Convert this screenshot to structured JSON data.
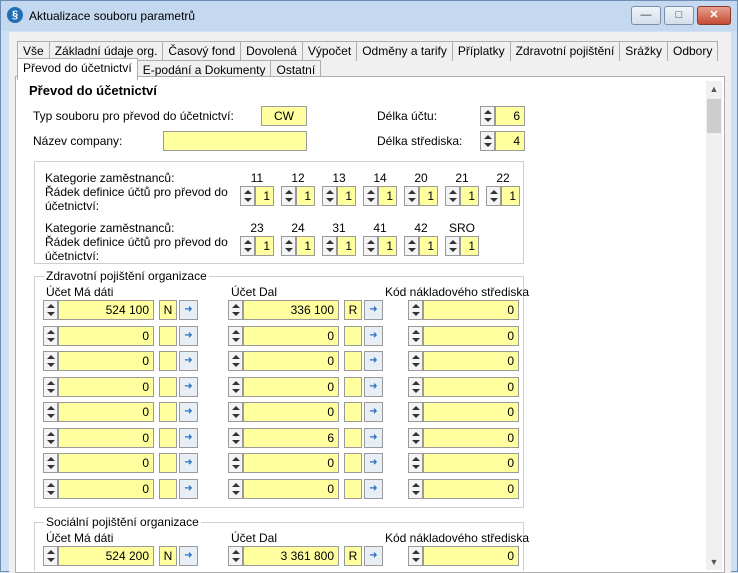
{
  "window": {
    "title": "Aktualizace souboru parametrů",
    "min_label": "—",
    "max_label": "□",
    "close_label": "✕",
    "icon": "app-logo-icon"
  },
  "tabs_row1": [
    "Vše",
    "Základní údaje org.",
    "Časový fond",
    "Dovolená",
    "Výpočet",
    "Odměny a tarify",
    "Příplatky",
    "Zdravotní pojištění",
    "Srážky",
    "Odbory"
  ],
  "tabs_row2": [
    "Převod do účetnictví",
    "E-podání a Dokumenty",
    "Ostatní"
  ],
  "active_tab": "Převod do účetnictví",
  "section_title": "Převod do účetnictví",
  "general": {
    "file_type_label": "Typ souboru pro převod do účetnictví:",
    "file_type_value": "CW",
    "company_label": "Název company:",
    "company_value": "",
    "account_len_label": "Délka účtu:",
    "account_len_value": "6",
    "center_len_label": "Délka střediska:",
    "center_len_value": "4"
  },
  "categories": {
    "cat_label": "Kategorie zaměstnanců:",
    "row_label": "Řádek definice účtů pro převod do účetnictví:",
    "row1": [
      {
        "cat": "11",
        "val": "1"
      },
      {
        "cat": "12",
        "val": "1"
      },
      {
        "cat": "13",
        "val": "1"
      },
      {
        "cat": "14",
        "val": "1"
      },
      {
        "cat": "20",
        "val": "1"
      },
      {
        "cat": "21",
        "val": "1"
      },
      {
        "cat": "22",
        "val": "1"
      }
    ],
    "row2": [
      {
        "cat": "23",
        "val": "1"
      },
      {
        "cat": "24",
        "val": "1"
      },
      {
        "cat": "31",
        "val": "1"
      },
      {
        "cat": "41",
        "val": "1"
      },
      {
        "cat": "42",
        "val": "1"
      },
      {
        "cat": "SRO",
        "val": "1"
      }
    ]
  },
  "health": {
    "group_label": "Zdravotní pojištění organizace",
    "col_debit": "Účet Má dáti",
    "col_credit": "Účet Dal",
    "col_center": "Kód nákladového střediska",
    "rows": [
      {
        "debit": "524 100",
        "dflag": "N",
        "credit": "336 100",
        "cflag": "R",
        "center": "0"
      },
      {
        "debit": "0",
        "dflag": "",
        "credit": "0",
        "cflag": "",
        "center": "0"
      },
      {
        "debit": "0",
        "dflag": "",
        "credit": "0",
        "cflag": "",
        "center": "0"
      },
      {
        "debit": "0",
        "dflag": "",
        "credit": "0",
        "cflag": "",
        "center": "0"
      },
      {
        "debit": "0",
        "dflag": "",
        "credit": "0",
        "cflag": "",
        "center": "0"
      },
      {
        "debit": "0",
        "dflag": "",
        "credit": "6",
        "cflag": "",
        "center": "0"
      },
      {
        "debit": "0",
        "dflag": "",
        "credit": "0",
        "cflag": "",
        "center": "0"
      },
      {
        "debit": "0",
        "dflag": "",
        "credit": "0",
        "cflag": "",
        "center": "0"
      }
    ]
  },
  "social": {
    "group_label": "Sociální pojištění organizace",
    "col_debit": "Účet Má dáti",
    "col_credit": "Účet Dal",
    "col_center": "Kód nákladového střediska",
    "rows": [
      {
        "debit": "524 200",
        "dflag": "N",
        "credit": "3 361 800",
        "cflag": "R",
        "center": "0"
      }
    ]
  }
}
